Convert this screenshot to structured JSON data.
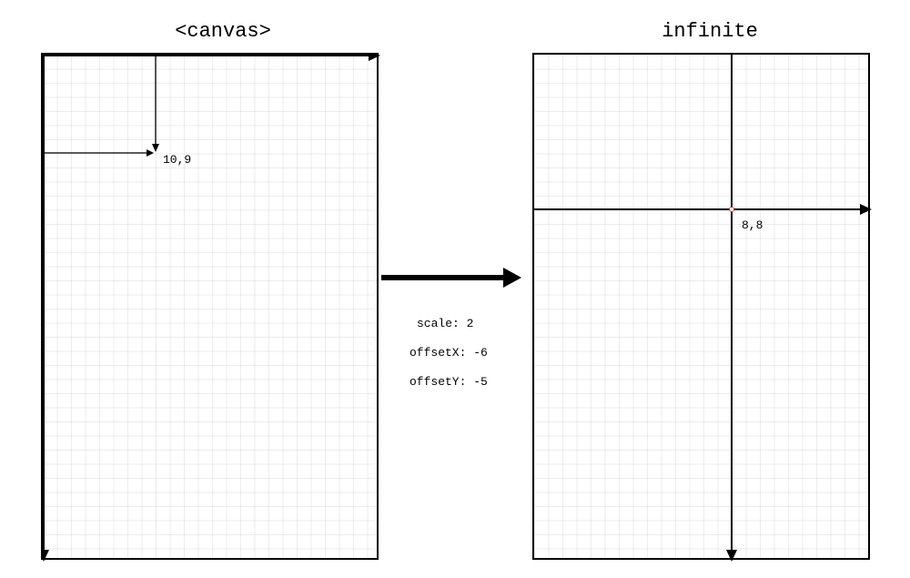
{
  "left_panel": {
    "title": "<canvas>",
    "point_label": "10,9"
  },
  "right_panel": {
    "title": "infinite",
    "point_label": "8,8"
  },
  "transform": {
    "scale_line": "scale: 2",
    "offsetx_line": "offsetX: -6",
    "offsety_line": "offsetY: -5"
  }
}
